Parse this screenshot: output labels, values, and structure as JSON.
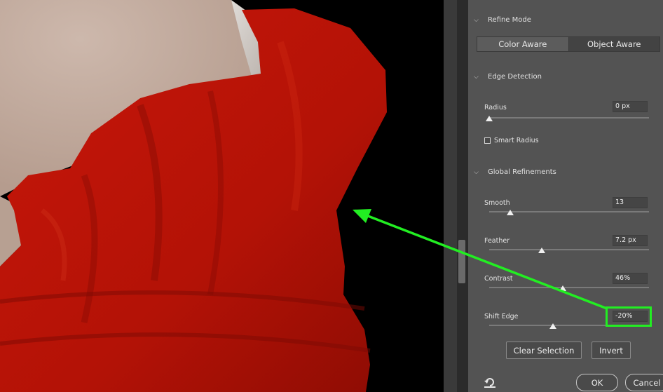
{
  "panel": {
    "refine_mode": {
      "title": "Refine Mode",
      "options": [
        "Color Aware",
        "Object Aware"
      ],
      "selected": "Object Aware"
    },
    "edge_detection": {
      "title": "Edge Detection",
      "radius_label": "Radius",
      "radius_value": "0 px",
      "radius_level": 0,
      "smart_radius_label": "Smart Radius",
      "smart_radius_checked": false
    },
    "global_refinements": {
      "title": "Global Refinements",
      "smooth_label": "Smooth",
      "smooth_value": "13",
      "smooth_level": 0.13,
      "feather_label": "Feather",
      "feather_value": "7.2 px",
      "feather_level": 0.33,
      "contrast_label": "Contrast",
      "contrast_value": "46%",
      "contrast_level": 0.46,
      "shift_edge_label": "Shift Edge",
      "shift_edge_value": "-20%",
      "shift_edge_level": 0.4
    },
    "clear_selection_label": "Clear Selection",
    "invert_label": "Invert",
    "ok_label": "OK",
    "cancel_label": "Cancel"
  },
  "colors": {
    "panel_bg": "#535353",
    "annotation": "#22ee22",
    "fabric_red": "#b81308",
    "skin": "#c4ada0"
  },
  "icons": {
    "chevron": "chevron-down-icon",
    "reset": "reset-icon"
  }
}
